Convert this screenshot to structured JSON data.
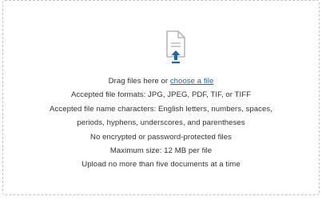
{
  "dropzone": {
    "drag_prefix": "Drag files here or ",
    "choose_link": "choose a file",
    "rules": [
      "Accepted file formats: JPG, JPEG, PDF, TIF, or TIFF",
      "Accepted file name characters: English letters, numbers, spaces,",
      "periods, hyphens, underscores, and parentheses",
      "No encrypted or password-protected files",
      "Maximum size: 12 MB per file",
      "Upload no more than five documents at a time"
    ],
    "icon": "file-upload-icon"
  },
  "colors": {
    "border": "#c4c4c4",
    "icon_outline": "#b9b9b9",
    "icon_arrow": "#1a6aa8",
    "link": "#1a6aa8",
    "text": "#333333"
  }
}
